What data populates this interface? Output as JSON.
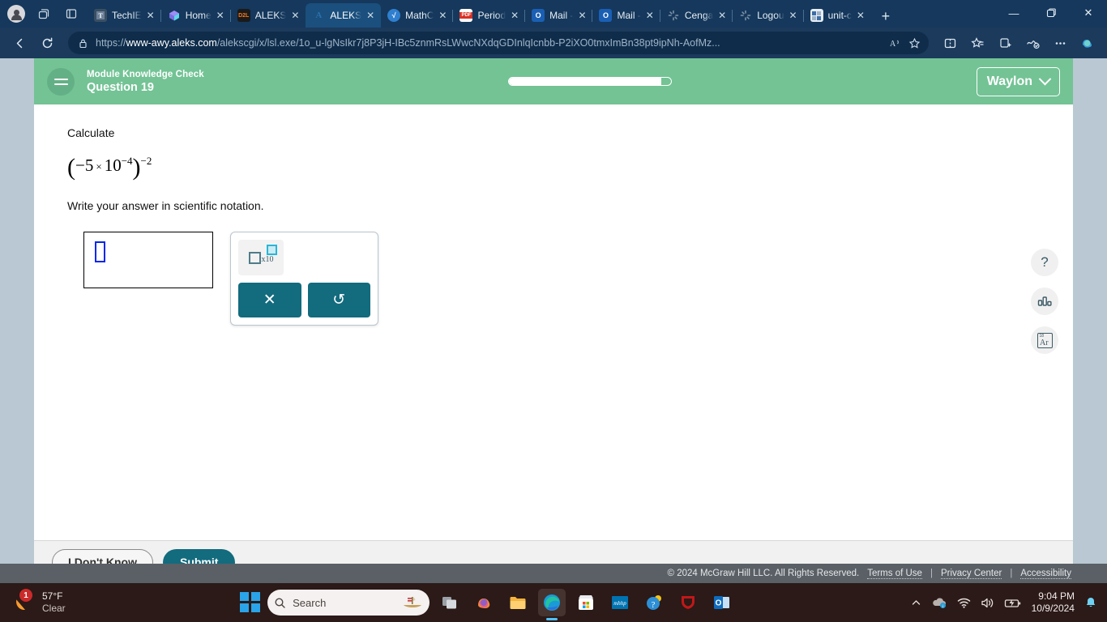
{
  "browser": {
    "tabs": [
      {
        "label": "TechIE",
        "icon": "tech-favicon",
        "active": false
      },
      {
        "label": "Home",
        "icon": "home-favicon",
        "active": false
      },
      {
        "label": "ALEKS",
        "icon": "d2l-favicon",
        "active": false
      },
      {
        "label": "ALEKS",
        "icon": "aleks-favicon",
        "active": true
      },
      {
        "label": "MathC",
        "icon": "math-favicon",
        "active": false
      },
      {
        "label": "Period",
        "icon": "pdf-favicon",
        "active": false
      },
      {
        "label": "Mail -",
        "icon": "outlook-favicon",
        "active": false
      },
      {
        "label": "Mail -",
        "icon": "outlook-favicon",
        "active": false
      },
      {
        "label": "Cenga",
        "icon": "loading-favicon",
        "active": false
      },
      {
        "label": "Logou",
        "icon": "loading-favicon",
        "active": false
      },
      {
        "label": "unit-c",
        "icon": "app-favicon",
        "active": false
      }
    ],
    "new_tab_label": "+",
    "close_label": "✕",
    "window_minimize": "—",
    "window_maximize": "❐",
    "window_close": "✕",
    "url_prefix": "https://",
    "url_domain": "www-awy.aleks.com",
    "url_path": "/alekscgi/x/lsl.exe/1o_u-lgNsIkr7j8P3jH-IBc5znmRsLWwcNXdqGDInlqIcnbb-P2iXO0tmxImBn38pt9ipNh-AofMz...",
    "back_label": "←",
    "forward_label": "→",
    "refresh_label": "↻"
  },
  "aleks": {
    "header": {
      "subtitle": "Module Knowledge Check",
      "title": "Question 19",
      "progress_percent": 94,
      "user_name": "Waylon"
    },
    "question": {
      "prompt": "Calculate",
      "expression_base": "−5",
      "expression_times": "×",
      "expression_power_base": "10",
      "expression_inner_exponent": "−4",
      "expression_outer_exponent": "−2",
      "instruction": "Write your answer in scientific notation."
    },
    "answer": {
      "value": "",
      "cursor_present": true
    },
    "palette": {
      "scinotation_label": "x10",
      "clear_label": "✕",
      "undo_label": "↺"
    },
    "side_tools": [
      {
        "name": "help",
        "label": "?"
      },
      {
        "name": "data-chart",
        "label": "bar-chart"
      },
      {
        "name": "periodic-table",
        "label": "Ar",
        "atomic_number": "18"
      }
    ],
    "footer": {
      "dont_know_label": "I Don't Know",
      "submit_label": "Submit"
    },
    "copyright": {
      "text": "© 2024 McGraw Hill LLC. All Rights Reserved.",
      "terms": "Terms of Use",
      "privacy": "Privacy Center",
      "accessibility": "Accessibility",
      "separator": "|"
    }
  },
  "taskbar": {
    "weather_temp": "57°F",
    "weather_condition": "Clear",
    "weather_badge": "1",
    "search_placeholder": "Search",
    "time": "9:04 PM",
    "date": "10/9/2024"
  },
  "colors": {
    "aleks_green": "#73c395",
    "aleks_teal": "#136b7e",
    "browser_blue": "#1b3a5c",
    "cursor_blue": "#0026e8"
  }
}
